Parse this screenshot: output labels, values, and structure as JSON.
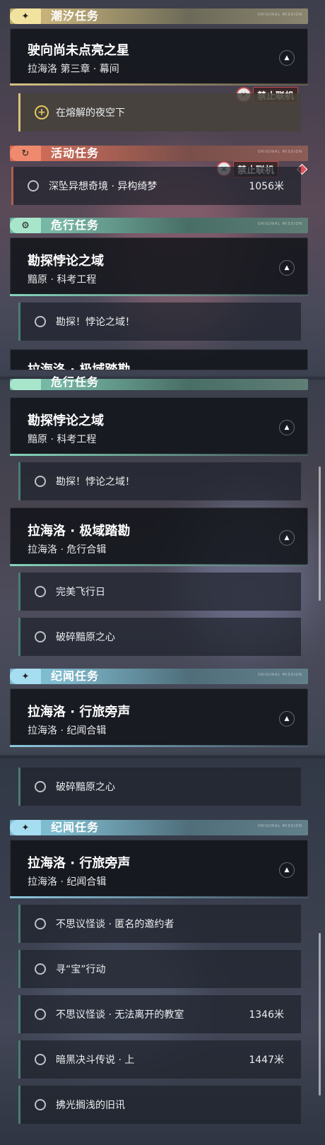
{
  "colors": {
    "gold": "#f2e2a0",
    "red": "#f08a6e",
    "teal": "#a8e6cc",
    "cyan": "#a6ddf0",
    "no_coop_red": "#c24a4a"
  },
  "icons": {
    "tide": "sparkle-star-icon",
    "event": "refresh-arrow-icon",
    "danger": "gear-eye-icon",
    "chronicle": "sparkle-star-icon",
    "nav": "navigation-arrow-icon",
    "no_coop": "no-coop-icon",
    "quest_add": "plus-circle-icon"
  },
  "shot1": {
    "tide": {
      "title": "潮汐任务",
      "tag": "ORIGINAL MISSION"
    },
    "tide_card": {
      "name": "驶向尚未点亮之星",
      "sub": "拉海洛 第三章 · 幕间"
    },
    "no_coop_1": "禁止联机",
    "tide_task": "在熔解的夜空下",
    "event": {
      "title": "活动任务",
      "tag": "ORIGINAL MISSION"
    },
    "no_coop_2": "禁止联机",
    "event_task": {
      "label": "深坠异想奇境 · 异构绮梦",
      "dist": "1056米"
    },
    "danger": {
      "title": "危行任务",
      "tag": "ORIGINAL MISSION"
    },
    "danger_card": {
      "name": "勘探悖论之域",
      "sub": "黯原 · 科考工程"
    },
    "danger_task": "勘探！悖论之域！",
    "peek_card": {
      "name": "拉海洛 · 极域踏勘"
    }
  },
  "shot2": {
    "danger_peek": "危行任务",
    "danger_card": {
      "name": "勘探悖论之域",
      "sub": "黯原 · 科考工程"
    },
    "danger_task": "勘探！悖论之域！",
    "polar_card": {
      "name": "拉海洛 · 极域踏勘",
      "sub": "拉海洛 · 危行合辑"
    },
    "polar_tasks": [
      "完美飞行日",
      "破碎黯原之心"
    ],
    "chron": {
      "title": "纪闻任务",
      "tag": "ORIGINAL MISSION"
    },
    "chron_card": {
      "name": "拉海洛 · 行旅旁声",
      "sub": "拉海洛 · 纪闻合辑"
    }
  },
  "shot3": {
    "top_task": "破碎黯原之心",
    "chron": {
      "title": "纪闻任务",
      "tag": "ORIGINAL MISSION"
    },
    "chron_card": {
      "name": "拉海洛 · 行旅旁声",
      "sub": "拉海洛 · 纪闻合辑"
    },
    "tasks": [
      {
        "label": "不思议怪谈 · 匿名的邀约者",
        "dist": ""
      },
      {
        "label": "寻“宝”行动",
        "dist": ""
      },
      {
        "label": "不思议怪谈 · 无法离开的教室",
        "dist": "1346米"
      },
      {
        "label": "暗黑决斗传说 · 上",
        "dist": "1447米"
      },
      {
        "label": "拂光搁浅的旧讯",
        "dist": ""
      }
    ]
  }
}
